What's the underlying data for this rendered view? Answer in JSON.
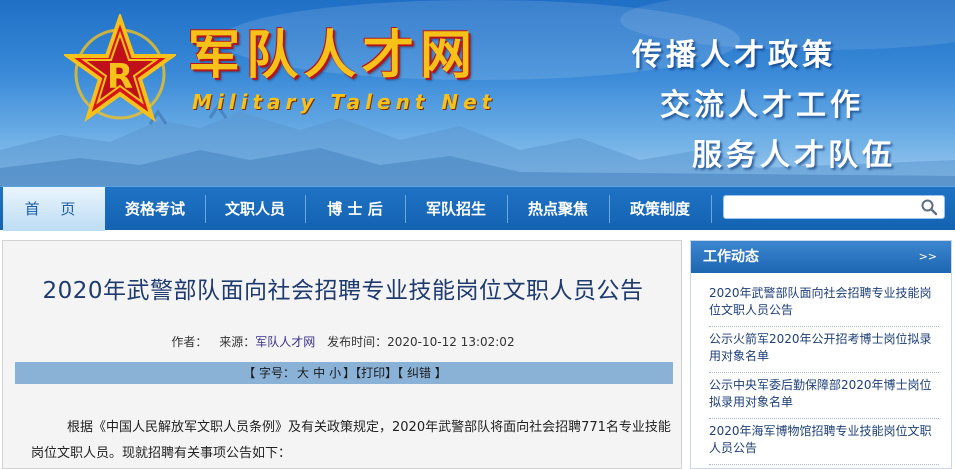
{
  "header": {
    "site_title": "军队人才网",
    "site_title_en": "Military Talent Net",
    "slogans": [
      "传播人才政策",
      "交流人才工作",
      "服务人才队伍"
    ]
  },
  "nav": {
    "items": [
      "首 页",
      "资格考试",
      "文职人员",
      "博 士 后",
      "军队招生",
      "热点聚焦",
      "政策制度"
    ],
    "active_index": 0,
    "search": {
      "value": "",
      "icon": "search-icon"
    }
  },
  "article": {
    "title": "2020年武警部队面向社会招聘专业技能岗位文职人员公告",
    "meta": {
      "author_label": "作者：",
      "source_label": "来源：",
      "source_value": "军队人才网",
      "time_label": "发布时间：",
      "time_value": "2020-10-12 13:02:02"
    },
    "toolbar": {
      "font_open": "【 字号：",
      "font_large": "大",
      "font_medium": "中",
      "font_small": "小",
      "font_close": "】",
      "print": "【打印】",
      "error": "【 纠错 】"
    },
    "body": "根据《中国人民解放军文职人员条例》及有关政策规定，2020年武警部队将面向社会招聘771名专业技能岗位文职人员。现就招聘有关事项公告如下："
  },
  "sidebar": {
    "title": "工作动态",
    "more": ">>",
    "items": [
      "2020年武警部队面向社会招聘专业技能岗位文职人员公告",
      "公示火箭军2020年公开招考博士岗位拟录用对象名单",
      "公示中央军委后勤保障部2020年博士岗位拟录用对象名单",
      "2020年海军博物馆招聘专业技能岗位文职人员公告"
    ]
  },
  "colors": {
    "nav_blue": "#1462b2",
    "title_gold": "#f6c21a",
    "toolbar_blue": "#8ab1d6"
  }
}
